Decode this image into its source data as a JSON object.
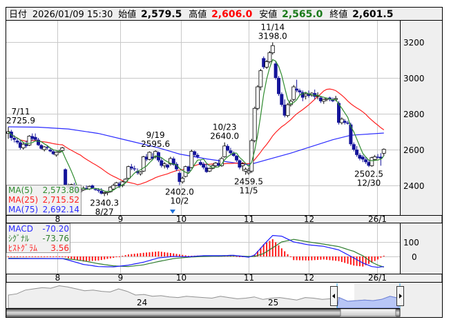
{
  "header": {
    "date_label": "日付",
    "date_value": "2026/01/09 15:30",
    "open_label": "始値",
    "open_value": "2,579.5",
    "high_label": "高値",
    "high_value": "2,606.0",
    "low_label": "安値",
    "low_value": "2,565.0",
    "close_label": "終値",
    "close_value": "2,601.5"
  },
  "colors": {
    "up_fill": "#ffffff",
    "down_fill": "#14149a",
    "ma5": "#2e8b2e",
    "ma25": "#ff2020",
    "ma75": "#2a2aff",
    "macd": "#1a1aff",
    "signal": "#2e7d2e",
    "histogram": "#ff1a1a",
    "high_value": "#ff0000",
    "low_value": "#1a7a1a"
  },
  "legend_ma": [
    {
      "label": "MA(5)",
      "value": "2,573.80"
    },
    {
      "label": "MA(25)",
      "value": "2,715.52"
    },
    {
      "label": "MA(75)",
      "value": "2,692.14"
    }
  ],
  "legend_macd": [
    {
      "label": "MACD",
      "value": "-70.20"
    },
    {
      "label": "ｼｸﾞﾅﾙ",
      "value": "-73.76"
    },
    {
      "label": "ﾋｽﾄｸﾞﾗﾑ",
      "value": "3.56"
    }
  ],
  "navigator": {
    "year_labels": [
      "24",
      "25"
    ],
    "values": [
      40,
      42,
      48,
      50,
      52,
      51,
      55,
      53,
      50,
      47,
      48,
      46,
      45,
      50,
      46,
      40,
      41,
      38,
      39,
      37,
      36,
      38,
      37,
      36,
      35,
      38,
      36,
      34,
      35,
      37,
      33,
      35,
      36,
      34,
      32,
      36,
      35,
      33,
      34,
      36,
      30,
      31,
      32,
      31,
      33,
      38,
      35
    ]
  },
  "chart_data": [
    {
      "type": "candlestick",
      "title": "",
      "x_tick_labels": [
        "8",
        "9",
        "10",
        "11",
        "12",
        "26/1"
      ],
      "x_tick_index": [
        16.3,
        37.2,
        57.5,
        80,
        100,
        122.8
      ],
      "y_ticks": [
        3200,
        3000,
        2800,
        2600,
        2400
      ],
      "ylim": [
        2250,
        3320
      ],
      "grid": true,
      "legend_placement": "bottom-left",
      "ohlc": [
        [
          2690,
          2726,
          2660,
          2700
        ],
        [
          2700,
          2710,
          2650,
          2665
        ],
        [
          2665,
          2680,
          2640,
          2655
        ],
        [
          2650,
          2665,
          2630,
          2640
        ],
        [
          2640,
          2650,
          2600,
          2610
        ],
        [
          2610,
          2640,
          2600,
          2630
        ],
        [
          2630,
          2650,
          2610,
          2620
        ],
        [
          2625,
          2680,
          2620,
          2675
        ],
        [
          2675,
          2690,
          2650,
          2660
        ],
        [
          2670,
          2690,
          2650,
          2655
        ],
        [
          2655,
          2665,
          2620,
          2625
        ],
        [
          2625,
          2630,
          2600,
          2605
        ],
        [
          2600,
          2620,
          2590,
          2615
        ],
        [
          2615,
          2625,
          2600,
          2610
        ],
        [
          2600,
          2610,
          2585,
          2590
        ],
        [
          2590,
          2600,
          2570,
          2575
        ],
        [
          2570,
          2590,
          2560,
          2585
        ],
        [
          2585,
          2600,
          2580,
          2590
        ],
        [
          2595,
          2615,
          2590,
          2610
        ],
        [
          2490,
          2495,
          2395,
          2400
        ],
        [
          2390,
          2410,
          2375,
          2395
        ],
        [
          2395,
          2410,
          2390,
          2405
        ],
        [
          2400,
          2415,
          2380,
          2385
        ],
        [
          2380,
          2390,
          2360,
          2365
        ],
        [
          2365,
          2380,
          2360,
          2375
        ],
        [
          2375,
          2395,
          2370,
          2385
        ],
        [
          2385,
          2400,
          2375,
          2380
        ],
        [
          2380,
          2400,
          2375,
          2395
        ],
        [
          2400,
          2405,
          2380,
          2385
        ],
        [
          2380,
          2385,
          2370,
          2375
        ],
        [
          2375,
          2385,
          2360,
          2370
        ],
        [
          2370,
          2385,
          2350,
          2355
        ],
        [
          2355,
          2365,
          2340.3,
          2360
        ],
        [
          2360,
          2370,
          2345,
          2365
        ],
        [
          2365,
          2395,
          2360,
          2390
        ],
        [
          2380,
          2410,
          2375,
          2400
        ],
        [
          2400,
          2420,
          2395,
          2415
        ],
        [
          2410,
          2420,
          2385,
          2395
        ],
        [
          2400,
          2425,
          2390,
          2420
        ],
        [
          2420,
          2440,
          2415,
          2435
        ],
        [
          2440,
          2510,
          2435,
          2505
        ],
        [
          2505,
          2520,
          2485,
          2495
        ],
        [
          2495,
          2510,
          2480,
          2490
        ],
        [
          2480,
          2495,
          2460,
          2470
        ],
        [
          2465,
          2480,
          2455,
          2475
        ],
        [
          2480,
          2565,
          2475,
          2560
        ],
        [
          2560,
          2575,
          2535,
          2545
        ],
        [
          2545,
          2590,
          2540,
          2585
        ],
        [
          2560,
          2580,
          2545,
          2550
        ],
        [
          2560,
          2595.6,
          2550,
          2590
        ],
        [
          2585,
          2590,
          2530,
          2540
        ],
        [
          2540,
          2555,
          2500,
          2510
        ],
        [
          2510,
          2530,
          2495,
          2520
        ],
        [
          2515,
          2520,
          2490,
          2500
        ],
        [
          2520,
          2560,
          2510,
          2550
        ],
        [
          2550,
          2560,
          2510,
          2515
        ],
        [
          2520,
          2530,
          2480,
          2490
        ],
        [
          2470,
          2480,
          2402,
          2420
        ],
        [
          2420,
          2450,
          2410,
          2440
        ],
        [
          2450,
          2510,
          2445,
          2505
        ],
        [
          2505,
          2510,
          2470,
          2480
        ],
        [
          2500,
          2600,
          2495,
          2590
        ],
        [
          2590,
          2595,
          2560,
          2570
        ],
        [
          2570,
          2580,
          2550,
          2560
        ],
        [
          2530,
          2540,
          2510,
          2515
        ],
        [
          2520,
          2530,
          2490,
          2500
        ],
        [
          2500,
          2520,
          2470,
          2475
        ],
        [
          2480,
          2500,
          2475,
          2495
        ],
        [
          2495,
          2520,
          2490,
          2510
        ],
        [
          2510,
          2530,
          2500,
          2525
        ],
        [
          2525,
          2545,
          2505,
          2510
        ],
        [
          2510,
          2560,
          2505,
          2550
        ],
        [
          2560,
          2640,
          2555,
          2620
        ],
        [
          2620,
          2630,
          2590,
          2595
        ],
        [
          2595,
          2610,
          2570,
          2580
        ],
        [
          2580,
          2590,
          2560,
          2565
        ],
        [
          2565,
          2570,
          2530,
          2540
        ],
        [
          2540,
          2545,
          2490,
          2500
        ],
        [
          2510,
          2530,
          2480,
          2520
        ],
        [
          2480,
          2500,
          2460,
          2490
        ],
        [
          2470,
          2500,
          2459.5,
          2480
        ],
        [
          2480,
          2660,
          2470,
          2650
        ],
        [
          2650,
          2840,
          2640,
          2830
        ],
        [
          2830,
          2960,
          2820,
          2950
        ],
        [
          2950,
          3050,
          2930,
          3040
        ],
        [
          3110,
          3120,
          3050,
          3060
        ],
        [
          3060,
          3100,
          3050,
          3090
        ],
        [
          3090,
          3150,
          3080,
          3140
        ],
        [
          3140,
          3198,
          3130,
          3180
        ],
        [
          3080,
          3090,
          2990,
          3000
        ],
        [
          3000,
          3010,
          2900,
          2910
        ],
        [
          2910,
          2920,
          2840,
          2850
        ],
        [
          2850,
          2880,
          2780,
          2790
        ],
        [
          2790,
          2860,
          2780,
          2850
        ],
        [
          2850,
          2880,
          2840,
          2870
        ],
        [
          2880,
          2960,
          2870,
          2950
        ],
        [
          2940,
          2990,
          2920,
          2930
        ],
        [
          2930,
          2940,
          2905,
          2920
        ],
        [
          2920,
          2930,
          2870,
          2890
        ],
        [
          2900,
          2920,
          2880,
          2910
        ],
        [
          2910,
          2930,
          2890,
          2900
        ],
        [
          2905,
          2920,
          2895,
          2915
        ],
        [
          2915,
          2935,
          2880,
          2895
        ],
        [
          2900,
          2920,
          2880,
          2900
        ],
        [
          2890,
          2900,
          2860,
          2870
        ],
        [
          2870,
          2885,
          2855,
          2880
        ],
        [
          2880,
          2890,
          2870,
          2885
        ],
        [
          2890,
          2895,
          2870,
          2880
        ],
        [
          2880,
          2890,
          2865,
          2870
        ],
        [
          2880,
          2900,
          2870,
          2885
        ],
        [
          2860,
          2870,
          2740,
          2750
        ],
        [
          2750,
          2780,
          2740,
          2770
        ],
        [
          2760,
          2770,
          2740,
          2750
        ],
        [
          2750,
          2760,
          2740,
          2745
        ],
        [
          2740,
          2750,
          2620,
          2630
        ],
        [
          2630,
          2640,
          2590,
          2600
        ],
        [
          2600,
          2620,
          2560,
          2570
        ],
        [
          2570,
          2580,
          2540,
          2550
        ],
        [
          2560,
          2570,
          2530,
          2545
        ],
        [
          2545,
          2560,
          2520,
          2530
        ],
        [
          2530,
          2540,
          2502.5,
          2510
        ],
        [
          2510,
          2560,
          2505,
          2555
        ],
        [
          2545,
          2570,
          2540,
          2560
        ],
        [
          2560,
          2575,
          2550,
          2555
        ],
        [
          2560,
          2580,
          2510,
          2550
        ],
        [
          2579.5,
          2606,
          2565,
          2601.5
        ]
      ],
      "ma75_points": [
        [
          0,
          2727
        ],
        [
          10,
          2725
        ],
        [
          20,
          2715
        ],
        [
          30,
          2690
        ],
        [
          40,
          2650
        ],
        [
          50,
          2610
        ],
        [
          57,
          2575
        ],
        [
          66,
          2548
        ],
        [
          80,
          2515
        ],
        [
          94,
          2580
        ],
        [
          108,
          2655
        ],
        [
          114,
          2680
        ],
        [
          125,
          2692.14
        ]
      ],
      "annotations": [
        {
          "date": "7/11",
          "value": "2725.9",
          "index": 0,
          "pos": "above"
        },
        {
          "date": "8/27",
          "value": "2340.3",
          "index": 32,
          "pos": "below"
        },
        {
          "date": "9/19",
          "value": "2595.6",
          "index": 49,
          "pos": "above"
        },
        {
          "date": "10/2",
          "value": "2402.0",
          "index": 57,
          "pos": "below"
        },
        {
          "date": "10/23",
          "value": "2640.0",
          "index": 72,
          "pos": "above"
        },
        {
          "date": "11/5",
          "value": "2459.5",
          "index": 80,
          "pos": "below"
        },
        {
          "date": "11/14",
          "value": "3198.0",
          "index": 88,
          "pos": "above"
        },
        {
          "date": "12/30",
          "value": "2502.5",
          "index": 120,
          "pos": "below"
        }
      ]
    },
    {
      "type": "line",
      "title": "MACD",
      "y_ticks": [
        100,
        0
      ],
      "ylim": [
        -110,
        220
      ],
      "points": [
        [
          0,
          -15,
          -12
        ],
        [
          18,
          -15,
          -15
        ],
        [
          20,
          -25,
          -17
        ],
        [
          25,
          -55,
          -30
        ],
        [
          30,
          -70,
          -50
        ],
        [
          35,
          -72,
          -65
        ],
        [
          40,
          -60,
          -70
        ],
        [
          45,
          -40,
          -58
        ],
        [
          50,
          -10,
          -35
        ],
        [
          55,
          0,
          -15
        ],
        [
          60,
          -2,
          -5
        ],
        [
          65,
          5,
          0
        ],
        [
          70,
          5,
          2
        ],
        [
          75,
          8,
          5
        ],
        [
          80,
          -5,
          0
        ],
        [
          82,
          10,
          0
        ],
        [
          85,
          80,
          20
        ],
        [
          88,
          145,
          60
        ],
        [
          91,
          140,
          100
        ],
        [
          95,
          100,
          118
        ],
        [
          100,
          80,
          100
        ],
        [
          105,
          70,
          85
        ],
        [
          110,
          45,
          68
        ],
        [
          115,
          -10,
          35
        ],
        [
          118,
          -45,
          5
        ],
        [
          121,
          -70,
          -40
        ],
        [
          123,
          -75,
          -60
        ],
        [
          125,
          -70.2,
          -73.76
        ]
      ],
      "series": [
        "MACD",
        "シグナル",
        "ヒストグラム"
      ]
    }
  ]
}
